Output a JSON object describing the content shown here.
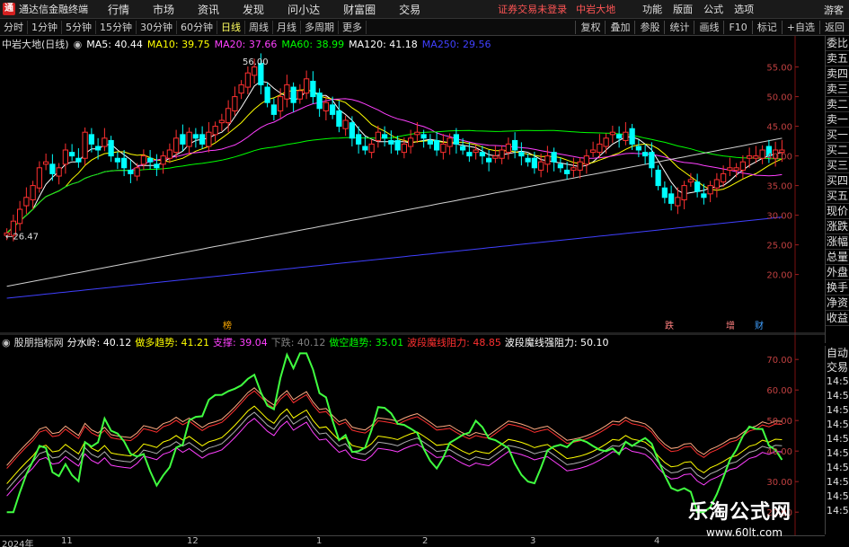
{
  "menubar": {
    "app_title": "通达信金融终端",
    "items": [
      "行情",
      "市场",
      "资讯",
      "发现",
      "问小达",
      "财富圈",
      "交易"
    ],
    "login_status": "证券交易未登录",
    "stock_name": "中岩大地",
    "right_items": [
      "功能",
      "版面",
      "公式",
      "选项"
    ],
    "guest": "游客"
  },
  "toolbar": {
    "periods": [
      "分时",
      "1分钟",
      "5分钟",
      "15分钟",
      "30分钟",
      "60分钟",
      "日线",
      "周线",
      "月线",
      "多周期",
      "更多"
    ],
    "active_period": "日线",
    "right_buttons": [
      "复权",
      "叠加",
      "参股",
      "统计",
      "画线",
      "F10",
      "标记",
      "+自选",
      "返回"
    ]
  },
  "main_chart": {
    "title": "中岩大地(日线)",
    "ma_labels": [
      {
        "text": "MA5: 40.44",
        "color": "#ffffff"
      },
      {
        "text": "MA10: 39.75",
        "color": "#ffff00"
      },
      {
        "text": "MA20: 37.66",
        "color": "#ff40ff"
      },
      {
        "text": "MA60: 38.99",
        "color": "#00ff00"
      },
      {
        "text": "MA120: 41.18",
        "color": "#ffffff"
      },
      {
        "text": "MA250: 29.56",
        "color": "#4040ff"
      }
    ],
    "y_ticks": [
      "55.00",
      "50.00",
      "45.00",
      "40.00",
      "35.00",
      "30.00",
      "25.00",
      "20.00"
    ],
    "high_label": "56.00",
    "low_label": "26.47",
    "event_markers": [
      {
        "text": "榜",
        "color": "#ffaa00"
      },
      {
        "text": "跌",
        "color": "#ff8080"
      },
      {
        "text": "增",
        "color": "#ff8080"
      },
      {
        "text": "财",
        "color": "#40a0ff"
      }
    ]
  },
  "indicator": {
    "name": "股朋指标网",
    "labels": [
      {
        "text": "分水岭: 40.12",
        "color": "#ffffff"
      },
      {
        "text": "做多趋势: 41.21",
        "color": "#ffff00"
      },
      {
        "text": "支撑: 39.04",
        "color": "#ff40ff"
      },
      {
        "text": "下跌: 40.12",
        "color": "#808080"
      },
      {
        "text": "做空趋势: 35.01",
        "color": "#00ff00"
      },
      {
        "text": "波段魔线阻力: 48.85",
        "color": "#ff3030"
      },
      {
        "text": "波段魔线强阻力: 50.10",
        "color": "#ffffff"
      }
    ],
    "y_ticks": [
      "70.00",
      "60.00",
      "50.00",
      "40.00",
      "30.00",
      "20.00"
    ]
  },
  "right_panel": {
    "items": [
      "委比",
      "卖五",
      "卖四",
      "卖三",
      "卖二",
      "卖一",
      "买一",
      "买二",
      "买三",
      "买四",
      "买五",
      "现价",
      "涨跌",
      "涨幅",
      "总量",
      "外盘",
      "换手",
      "净资",
      "收益"
    ],
    "lower_items": [
      "自动",
      "交易"
    ],
    "times": [
      "14:56",
      "14:56",
      "14:56",
      "14:56",
      "14:56",
      "14:56",
      "14:56",
      "14:56",
      "14:56",
      "14:56"
    ]
  },
  "date_axis": {
    "labels": [
      "2024年",
      "11",
      "12",
      "1",
      "2",
      "3",
      "4"
    ]
  },
  "watermark": {
    "title": "乐淘公式网",
    "url": "www.60lt.com"
  },
  "colors": {
    "up": "#ff3030",
    "down": "#00ffff",
    "ma5": "#ffffff",
    "ma10": "#ffff00",
    "ma20": "#ff40ff",
    "ma60": "#00ff00",
    "ma120": "#ffffff",
    "ma250": "#4040ff"
  }
}
